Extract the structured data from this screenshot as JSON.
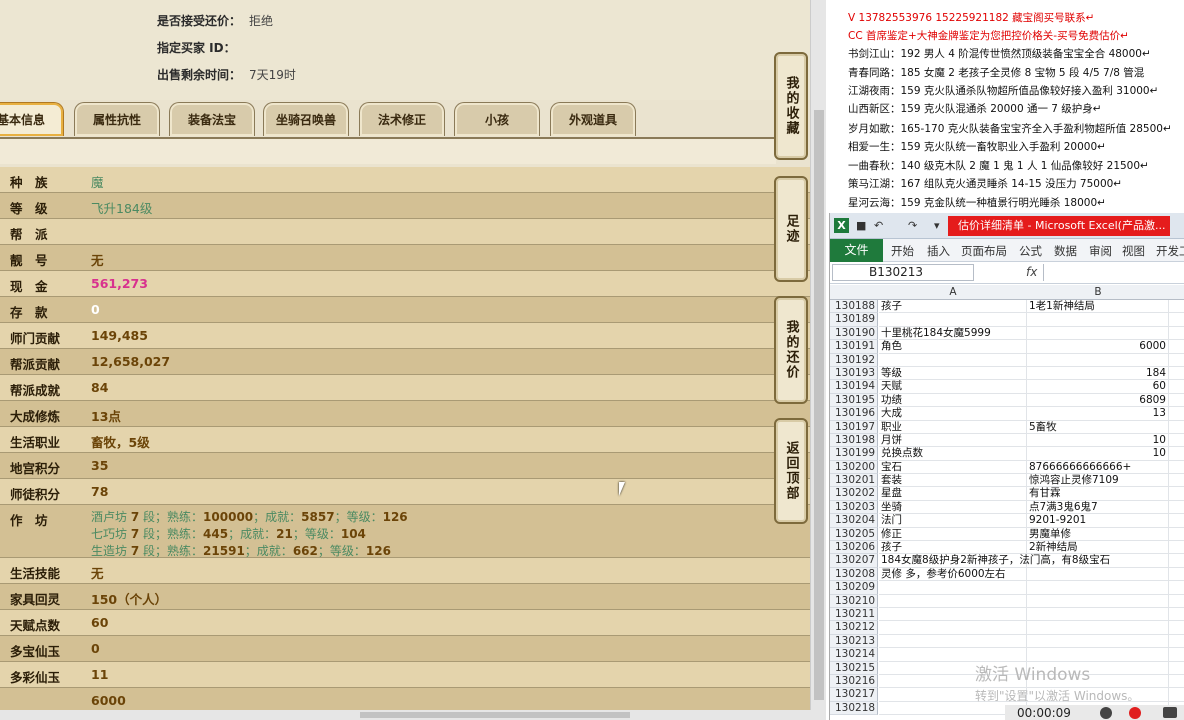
{
  "game": {
    "header": [
      {
        "label": "是否接受还价：",
        "value": "拒绝"
      },
      {
        "label": "指定买家 ID：",
        "value": ""
      },
      {
        "label": "出售剩余时间：",
        "value": "7天19时"
      }
    ],
    "tabs": [
      "基本信息",
      "属性抗性",
      "装备法宝",
      "坐骑召唤兽",
      "法术修正",
      "小孩",
      "外观道具"
    ],
    "active_tab": 0,
    "info_rows": [
      {
        "key": "种　族",
        "value": "魔",
        "style": "green"
      },
      {
        "key": "等　级",
        "value": "飞升184级",
        "style": "green"
      },
      {
        "key": "帮　派",
        "value": "",
        "style": "plain"
      },
      {
        "key": "靓　号",
        "value": "无",
        "style": "plain"
      },
      {
        "key": "现　金",
        "value": "561,273",
        "style": "pink"
      },
      {
        "key": "存　款",
        "value": "0",
        "style": "white"
      },
      {
        "key": "师门贡献",
        "value": "149,485",
        "style": "plain"
      },
      {
        "key": "帮派贡献",
        "value": "12,658,027",
        "style": "plain"
      },
      {
        "key": "帮派成就",
        "value": "84",
        "style": "plain"
      },
      {
        "key": "大成修炼",
        "value": "13点",
        "style": "plain"
      },
      {
        "key": "生活职业",
        "value": "畜牧，5级",
        "style": "plain"
      },
      {
        "key": "地宫积分",
        "value": "35",
        "style": "plain"
      },
      {
        "key": "师徒积分",
        "value": "78",
        "style": "plain"
      }
    ],
    "workshop": {
      "key": "作　坊",
      "lines": [
        {
          "name": "酒卢坊",
          "level": "7",
          "unit": "段；熟练：",
          "skill": "100000",
          "a": "；成就：",
          "ach": "5857",
          "b": "；等级：",
          "lv": "126"
        },
        {
          "name": "七巧坊",
          "level": "7",
          "unit": "段；熟练：",
          "skill": "445",
          "a": "；成就：",
          "ach": "21",
          "b": "；等级：",
          "lv": "104"
        },
        {
          "name": "生造坊",
          "level": "7",
          "unit": "段；熟练：",
          "skill": "21591",
          "a": "；成就：",
          "ach": "662",
          "b": "；等级：",
          "lv": "126"
        }
      ]
    },
    "info_rows_2": [
      {
        "key": "生活技能",
        "value": "无"
      },
      {
        "key": "家具回灵",
        "value": "150（个人）"
      },
      {
        "key": "天赋点数",
        "value": "60"
      },
      {
        "key": "多宝仙玉",
        "value": "0"
      },
      {
        "key": "多彩仙玉",
        "value": "11"
      },
      {
        "key": "",
        "value": "6000"
      }
    ],
    "side_buttons": [
      "我的收藏",
      "足迹",
      "我的还价",
      "返回顶部"
    ]
  },
  "doc": {
    "lines": [
      {
        "text": "V 13782553976   15225921182  藏宝阁买号联系↵",
        "red": true
      },
      {
        "text": "CC 首席鉴定+大神金牌鉴定为您把控价格关-买号免费估价↵",
        "red": true
      },
      {
        "name": "书剑江山：",
        "text": "192 男人 4 阶混传世愤然顶级装备宝宝全合 48000↵"
      },
      {
        "name": "青春同路：",
        "text": "185 女魔 2 老孩子全灵修 8 宝物 5 段 4/5 7/8 管混"
      },
      {
        "name": "江湖夜雨：",
        "text": "159 克火队通杀队物超所值品像较好接入盈利 31000↵"
      },
      {
        "name": "山西新区：",
        "text": "159 克火队混通杀 20000 通一 7 级护身↵"
      },
      {
        "name": "岁月如歌：",
        "text": "165-170 克火队装备宝宝齐全入手盈利物超所值 28500↵"
      },
      {
        "name": "相爱一生：",
        "text": "159 克火队统一畜牧职业入手盈利 20000↵"
      },
      {
        "name": "一曲春秋：",
        "text": "140 级克木队 2 魔 1 鬼 1 人 1 仙品像较好 21500↵"
      },
      {
        "name": "策马江湖：",
        "text": "167 组队克火通灵睡杀 14-15 没压力 75000↵"
      },
      {
        "name": "星河云海：",
        "text": "159 克金队统一种植景行明光睡杀 18000↵"
      }
    ]
  },
  "excel": {
    "title": "估价详细清单 - Microsoft Excel(产品激...",
    "tabs": [
      "文件",
      "开始",
      "插入",
      "页面布局",
      "公式",
      "数据",
      "审阅",
      "视图",
      "开发工"
    ],
    "name_box": "B130213",
    "fx": "fx",
    "col_headers": [
      "A",
      "B"
    ],
    "rows": [
      {
        "n": "130188",
        "a": "孩子",
        "b": "1老1新神结局",
        "num": false
      },
      {
        "n": "130189",
        "a": "",
        "b": "",
        "num": false
      },
      {
        "n": "130190",
        "a": "十里桃花184女魔5999",
        "b": "",
        "num": false
      },
      {
        "n": "130191",
        "a": "角色",
        "b": "6000",
        "num": true
      },
      {
        "n": "130192",
        "a": "",
        "b": "",
        "num": false
      },
      {
        "n": "130193",
        "a": "等级",
        "b": "184",
        "num": true
      },
      {
        "n": "130194",
        "a": "天赋",
        "b": "60",
        "num": true
      },
      {
        "n": "130195",
        "a": "功绩",
        "b": "6809",
        "num": true
      },
      {
        "n": "130196",
        "a": "大成",
        "b": "13",
        "num": true
      },
      {
        "n": "130197",
        "a": "职业",
        "b": "5畜牧",
        "num": false
      },
      {
        "n": "130198",
        "a": "月饼",
        "b": "10",
        "num": true
      },
      {
        "n": "130199",
        "a": "兑换点数",
        "b": "10",
        "num": true
      },
      {
        "n": "130200",
        "a": "宝石",
        "b": "87666666666666+",
        "num": false
      },
      {
        "n": "130201",
        "a": "套装",
        "b": "惊鸿容止灵修7109",
        "num": false
      },
      {
        "n": "130202",
        "a": "星盘",
        "b": "有甘霖",
        "num": false
      },
      {
        "n": "130203",
        "a": "坐骑",
        "b": "点7满3鬼6鬼7",
        "num": false
      },
      {
        "n": "130204",
        "a": "法门",
        "b": "9201-9201",
        "num": false
      },
      {
        "n": "130205",
        "a": "修正",
        "b": "男魔单修",
        "num": false
      },
      {
        "n": "130206",
        "a": "孩子",
        "b": "2新神结局",
        "num": false
      },
      {
        "n": "130207",
        "a": "184女魔8级护身2新神孩子，法门高，有8级宝石",
        "b": "",
        "num": false
      },
      {
        "n": "130208",
        "a": "灵修 多，参考价6000左右",
        "b": "",
        "num": false
      },
      {
        "n": "130209",
        "a": "",
        "b": "",
        "num": false
      },
      {
        "n": "130210",
        "a": "",
        "b": "",
        "num": false
      },
      {
        "n": "130211",
        "a": "",
        "b": "",
        "num": false
      },
      {
        "n": "130212",
        "a": "",
        "b": "",
        "num": false
      },
      {
        "n": "130213",
        "a": "",
        "b": "",
        "num": false
      },
      {
        "n": "130214",
        "a": "",
        "b": "",
        "num": false
      },
      {
        "n": "130215",
        "a": "",
        "b": "",
        "num": false
      },
      {
        "n": "130216",
        "a": "",
        "b": "",
        "num": false
      },
      {
        "n": "130217",
        "a": "",
        "b": "",
        "num": false
      },
      {
        "n": "130218",
        "a": "",
        "b": "",
        "num": false
      }
    ]
  },
  "watermark": {
    "line1": "激活 Windows",
    "line2": "转到\"设置\"以激活 Windows。"
  },
  "recorder": {
    "time": "00:00:09"
  }
}
